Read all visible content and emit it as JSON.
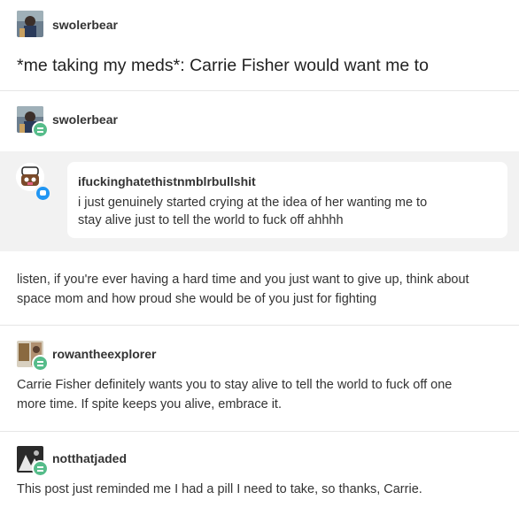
{
  "post1": {
    "username": "swolerbear",
    "text": "*me taking my meds*: Carrie Fisher would want me to"
  },
  "post2": {
    "username": "swolerbear",
    "reply": {
      "username": "ifuckinghatethistnmblrbullshit",
      "text_line1": "i just genuinely started crying at the idea of her wanting me to",
      "text_line2": "stay alive just to tell the world to fuck off ahhhh"
    },
    "text_line1": "listen, if you're ever having a hard time and you just want to give up, think about",
    "text_line2": "space mom and how proud she would be of you just for fighting"
  },
  "post3": {
    "username": "rowantheexplorer",
    "text_line1": "Carrie Fisher definitely wants you to stay alive to tell the world to fuck off one",
    "text_line2": "more time. If spite keeps you alive, embrace it."
  },
  "post4": {
    "username": "notthatjaded",
    "text": "This post just reminded me I had a pill I need to take, so thanks, Carrie."
  },
  "colors": {
    "reblog_badge": "#56bc8a",
    "reply_badge": "#2196f3",
    "reply_panel_bg": "#f2f2f2"
  }
}
